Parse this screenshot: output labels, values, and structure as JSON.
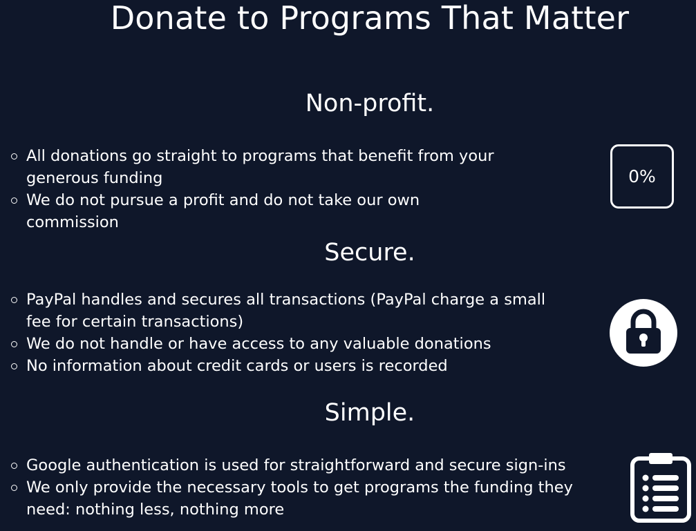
{
  "page": {
    "title": "Donate to Programs That Matter"
  },
  "sections": [
    {
      "heading": "Non-profit.",
      "icon": "zero-percent-icon",
      "icon_text": "0%",
      "bullets": [
        "All donations go straight to programs that benefit from your generous funding",
        "We do not pursue a profit and do not take our own commission"
      ]
    },
    {
      "heading": "Secure.",
      "icon": "lock-icon",
      "bullets": [
        "PayPal handles and secures all transactions (PayPal charge a small fee for certain transactions)",
        "We do not handle or have access to any valuable donations",
        "No information about credit cards or users is recorded"
      ]
    },
    {
      "heading": "Simple.",
      "icon": "clipboard-list-icon",
      "bullets": [
        "Google authentication is used for straightforward and secure sign-ins",
        "We only provide the necessary tools to get programs the funding they need: nothing less, nothing more"
      ]
    }
  ],
  "colors": {
    "background": "#0f172a",
    "text": "#ffffff"
  }
}
